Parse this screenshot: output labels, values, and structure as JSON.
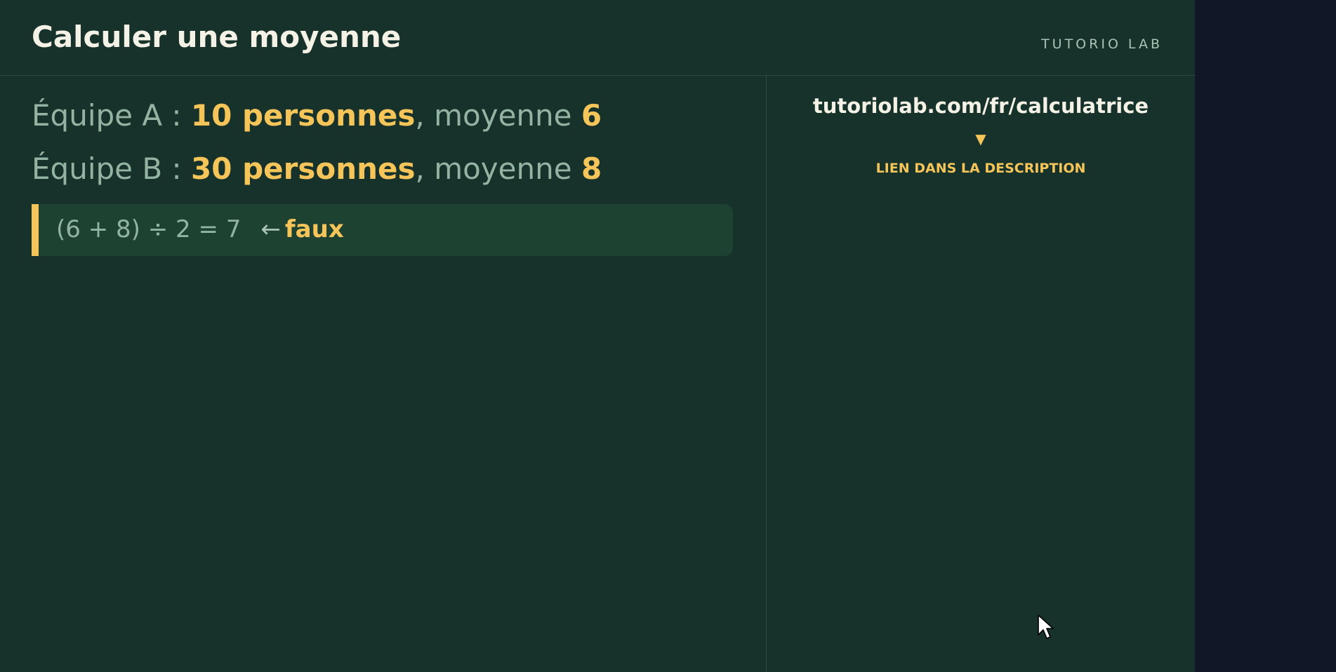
{
  "header": {
    "title": "Calculer une moyenne",
    "brand": "TUTORIO LAB"
  },
  "teams": [
    {
      "prefix": "Équipe A : ",
      "count": "10 personnes",
      "middle": ", moyenne ",
      "average": "6"
    },
    {
      "prefix": "Équipe B : ",
      "count": "30 personnes",
      "middle": ", moyenne ",
      "average": "8"
    }
  ],
  "formula": {
    "expression": "(6 + 8) ÷ 2 = 7",
    "arrow": "←",
    "verdict": "faux"
  },
  "sidebar": {
    "url": "tutoriolab.com/fr/calculatrice",
    "arrow": "▼",
    "cta": "LIEN DANS LA DESCRIPTION"
  },
  "icons": {
    "cursor": "mouse-pointer-icon"
  },
  "colors": {
    "board": "#16322a",
    "outside": "#121728",
    "highlight": "#f6c55a",
    "muted_text": "#93b3a3",
    "title_text": "#f4f1e6"
  }
}
